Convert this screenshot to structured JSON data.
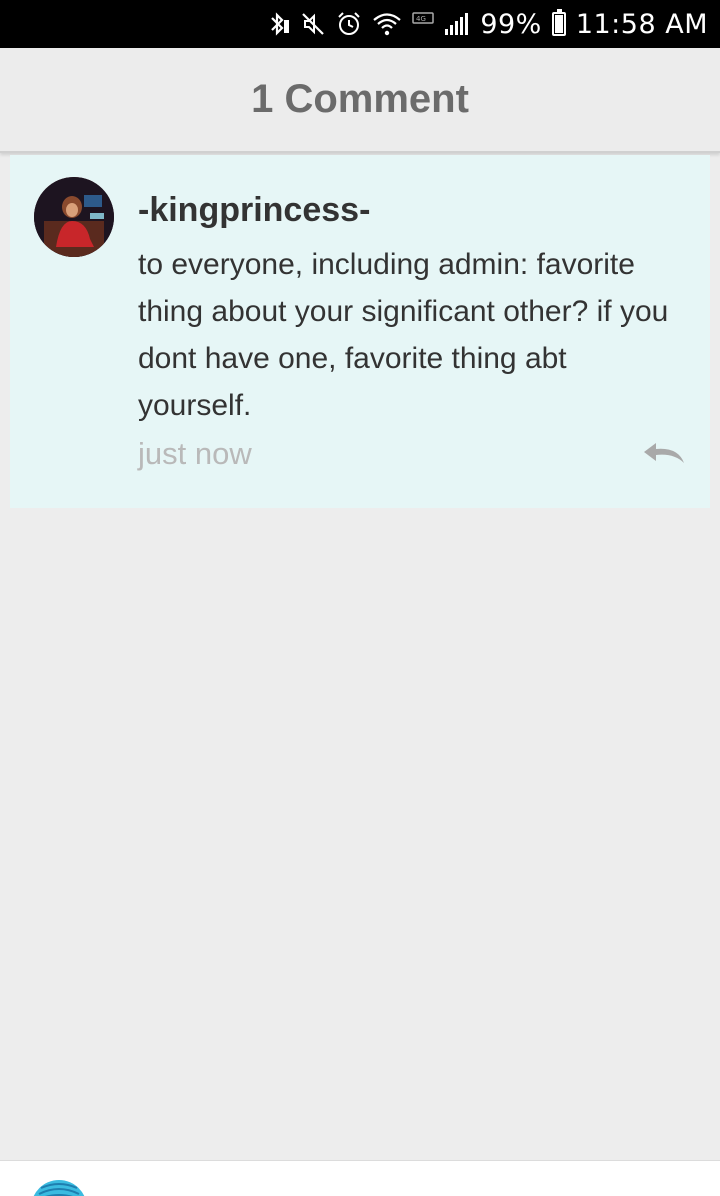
{
  "status_bar": {
    "battery_percent": "99%",
    "time": "11:58 AM",
    "icons": [
      "bluetooth-icon",
      "mute-icon",
      "alarm-icon",
      "wifi-icon",
      "data-icon",
      "signal-icon",
      "battery-icon"
    ]
  },
  "header": {
    "title": "1 Comment"
  },
  "comments": [
    {
      "username": "-kingprincess-",
      "text": "to everyone, including admin: favorite thing about your significant other? if you dont have one, favorite thing abt yourself.",
      "timestamp": "just now"
    }
  ],
  "colors": {
    "card_background": "#e6f6f6",
    "page_background": "#ededed",
    "header_text": "#6b6b6b",
    "timestamp_text": "#b9b9b9",
    "reply_icon": "#a9a9a9"
  }
}
